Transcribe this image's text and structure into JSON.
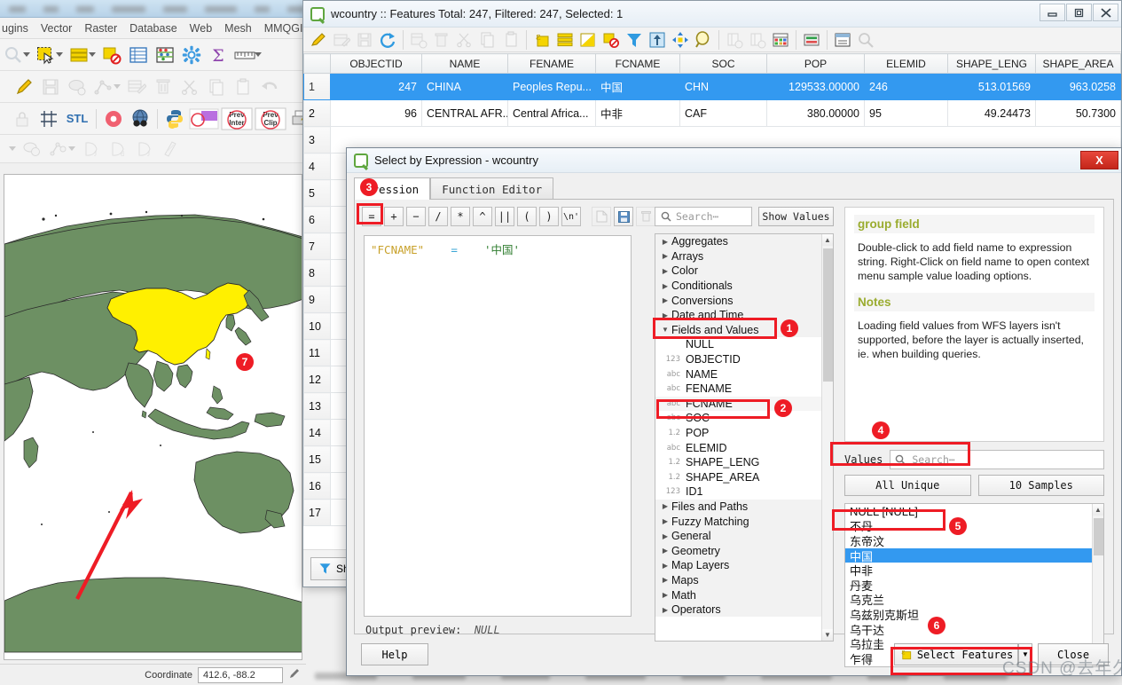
{
  "qgis": {
    "menu_items": [
      "ugins",
      "Vector",
      "Raster",
      "Database",
      "Web",
      "Mesh",
      "MMQGIS"
    ],
    "status_coordinate_label": "Coordinate",
    "status_coordinate_value": "412.6, -88.2",
    "toolbar_icons_row1": [
      "identify-icon",
      "select-features-icon",
      "select-by-value-icon",
      "deselect-icon",
      "open-attribute-table-icon",
      "field-calculator-icon",
      "processing-toolbox-icon",
      "statistics-icon",
      "measure-icon"
    ],
    "toolbar_icons_row2": [
      "toggle-editing-icon",
      "save-edits-icon",
      "add-polygon-icon",
      "vertex-tool-icon",
      "modify-attributes-icon",
      "delete-selected-icon",
      "cut-features-icon",
      "copy-features-icon",
      "paste-features-icon",
      "undo-icon"
    ],
    "toolbar_icons_row3": [
      "lock-icon",
      "grid-icon",
      "stl-icon",
      "donut-icon",
      "globe-binoculars-icon",
      "python-console-icon",
      "circle-overlay-icon",
      "prev-inter-icon",
      "prev-clip-icon",
      "print-layout-icon"
    ]
  },
  "map": {
    "annotation_badge": "7",
    "selected_country_color": "#fff000",
    "land_color": "#6d9063",
    "arrow_color": "#ee1c25"
  },
  "attribute_table": {
    "title": "wcountry :: Features Total: 247, Filtered: 247, Selected: 1",
    "window_buttons": [
      "minimize",
      "maximize",
      "close"
    ],
    "toolbar_icons": [
      "toggle-editing-icon",
      "save-edits-icon",
      "save-layer-edits-icon",
      "reload-icon",
      "add-feature-icon",
      "delete-selected-icon",
      "cut-icon",
      "copy-icon",
      "paste-icon",
      "select-by-expression-icon",
      "select-all-icon",
      "invert-selection-icon",
      "deselect-all-icon",
      "filter-icon",
      "move-selection-to-top-icon",
      "pan-to-selection-icon",
      "zoom-to-selection-icon",
      "new-field-icon",
      "delete-field-icon",
      "open-calculator-icon",
      "conditional-format-icon",
      "organize-columns-icon",
      "zoom-full-icon"
    ],
    "columns": [
      "OBJECTID",
      "NAME",
      "FENAME",
      "FCNAME",
      "SOC",
      "POP",
      "ELEMID",
      "SHAPE_LENG",
      "SHAPE_AREA"
    ],
    "rows": [
      {
        "num": "1",
        "selected": true,
        "cells": [
          "247",
          "CHINA",
          "Peoples Repu...",
          "中国",
          "CHN",
          "129533.00000",
          "246",
          "513.01569",
          "963.0258"
        ]
      },
      {
        "num": "2",
        "selected": false,
        "cells": [
          "96",
          "CENTRAL AFR...",
          "Central Africa...",
          "中非",
          "CAF",
          "380.00000",
          "95",
          "49.24473",
          "50.7300"
        ]
      }
    ],
    "empty_row_numbers": [
      "3",
      "4",
      "5",
      "6",
      "7",
      "8",
      "9",
      "10",
      "11",
      "12",
      "13",
      "14",
      "15",
      "16",
      "17"
    ],
    "filter_button": "Sh"
  },
  "dialog": {
    "title": "Select by Expression - wcountry",
    "close_label": "X",
    "tabs": [
      {
        "label": "pression",
        "active": true
      },
      {
        "label": "Function Editor",
        "active": false
      }
    ],
    "operator_buttons": [
      "=",
      "+",
      "−",
      "/",
      "*",
      "^",
      "||",
      "(",
      ")",
      "\\n'"
    ],
    "file_buttons": [
      "new-file-icon",
      "save-icon",
      "delete-icon"
    ],
    "expression": {
      "field": "\"FCNAME\"",
      "operator": "=",
      "value": "'中国'"
    },
    "output_preview_label": "Output preview:",
    "output_preview_value": "NULL",
    "search": {
      "placeholder": "Search⋯",
      "show_values_label": "Show Values"
    },
    "tree": [
      {
        "label": "Aggregates",
        "type": "group",
        "expanded": false
      },
      {
        "label": "Arrays",
        "type": "group",
        "expanded": false
      },
      {
        "label": "Color",
        "type": "group",
        "expanded": false
      },
      {
        "label": "Conditionals",
        "type": "group",
        "expanded": false
      },
      {
        "label": "Conversions",
        "type": "group",
        "expanded": false
      },
      {
        "label": "Date and Time",
        "type": "group",
        "expanded": false
      },
      {
        "label": "Fields and Values",
        "type": "group",
        "expanded": true
      },
      {
        "label": "NULL",
        "type": "field",
        "ftype": ""
      },
      {
        "label": "OBJECTID",
        "type": "field",
        "ftype": "123"
      },
      {
        "label": "NAME",
        "type": "field",
        "ftype": "abc"
      },
      {
        "label": "FENAME",
        "type": "field",
        "ftype": "abc"
      },
      {
        "label": "FCNAME",
        "type": "field",
        "ftype": "abc",
        "highlighted": true
      },
      {
        "label": "SOC",
        "type": "field",
        "ftype": "abc"
      },
      {
        "label": "POP",
        "type": "field",
        "ftype": "1.2"
      },
      {
        "label": "ELEMID",
        "type": "field",
        "ftype": "abc"
      },
      {
        "label": "SHAPE_LENG",
        "type": "field",
        "ftype": "1.2"
      },
      {
        "label": "SHAPE_AREA",
        "type": "field",
        "ftype": "1.2"
      },
      {
        "label": "ID1",
        "type": "field",
        "ftype": "123"
      },
      {
        "label": "Files and Paths",
        "type": "group",
        "expanded": false
      },
      {
        "label": "Fuzzy Matching",
        "type": "group",
        "expanded": false
      },
      {
        "label": "General",
        "type": "group",
        "expanded": false
      },
      {
        "label": "Geometry",
        "type": "group",
        "expanded": false
      },
      {
        "label": "Map Layers",
        "type": "group",
        "expanded": false
      },
      {
        "label": "Maps",
        "type": "group",
        "expanded": false
      },
      {
        "label": "Math",
        "type": "group",
        "expanded": false
      },
      {
        "label": "Operators",
        "type": "group",
        "expanded": false
      }
    ],
    "help": {
      "heading": "group field",
      "body": "Double-click to add field name to expression string. Right-Click on field name to open context menu sample value loading options.",
      "notes_heading": "Notes",
      "notes_body": "Loading field values from WFS layers isn't supported, before the layer is actually inserted, ie. when building queries."
    },
    "values": {
      "label": "Values",
      "search_placeholder": "Search⋯",
      "all_unique_label": "All Unique",
      "samples_label": "10 Samples",
      "items": [
        {
          "label": "NULL [NULL]",
          "selected": false
        },
        {
          "label": "不丹",
          "selected": false
        },
        {
          "label": "东帝汶",
          "selected": false
        },
        {
          "label": "中国",
          "selected": true
        },
        {
          "label": "中非",
          "selected": false
        },
        {
          "label": "丹麦",
          "selected": false
        },
        {
          "label": "乌克兰",
          "selected": false
        },
        {
          "label": "乌兹别克斯坦",
          "selected": false
        },
        {
          "label": "乌干达",
          "selected": false
        },
        {
          "label": "乌拉圭",
          "selected": false
        },
        {
          "label": "乍得",
          "selected": false
        }
      ]
    },
    "footer": {
      "help_label": "Help",
      "select_features_label": "Select Features",
      "close_label": "Close"
    }
  },
  "annotations": {
    "badges": [
      "1",
      "2",
      "3",
      "4",
      "5",
      "6",
      "7"
    ]
  },
  "watermark": "CSDN @去年久星"
}
